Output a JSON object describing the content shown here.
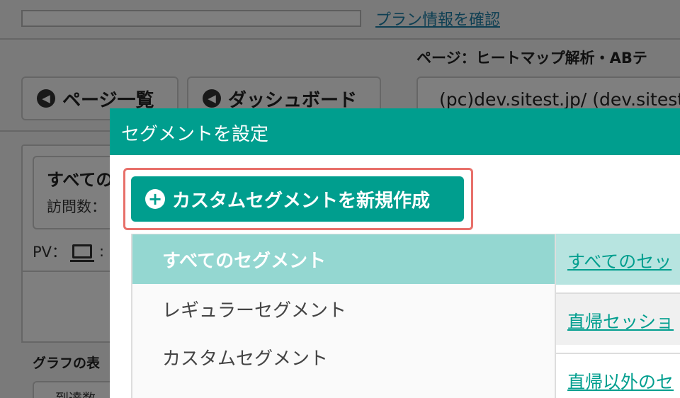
{
  "background": {
    "plan_link": "プラン情報を確認",
    "page_label": "ページ：ヒートマップ解析・ABテ",
    "nav": {
      "pages_label": "ページ一覧",
      "dashboard_label": "ダッシュボード"
    },
    "url_text": "(pc)dev.sitest.jp/ (dev.sitest",
    "segment_summary": {
      "name": "すべての",
      "visits": "訪問数：",
      "pv": "PV：",
      "pv_colon": ":"
    },
    "graph_label": "グラフの表",
    "bottom_chip": "到達数"
  },
  "modal": {
    "title": "セグメントを設定",
    "create_button_label": "カスタムセグメントを新規作成",
    "categories": [
      {
        "label": "すべてのセグメント",
        "active": true
      },
      {
        "label": "レギュラーセグメント",
        "active": false
      },
      {
        "label": "カスタムセグメント",
        "active": false
      }
    ],
    "segments": [
      {
        "label": "すべてのセッ"
      },
      {
        "label": "直帰セッショ"
      },
      {
        "label": "直帰以外のセ"
      }
    ]
  },
  "colors": {
    "accent": "#009e8e",
    "active_item": "#94d7d1",
    "highlight_border": "#e8706a",
    "link": "#1d7fa6"
  }
}
